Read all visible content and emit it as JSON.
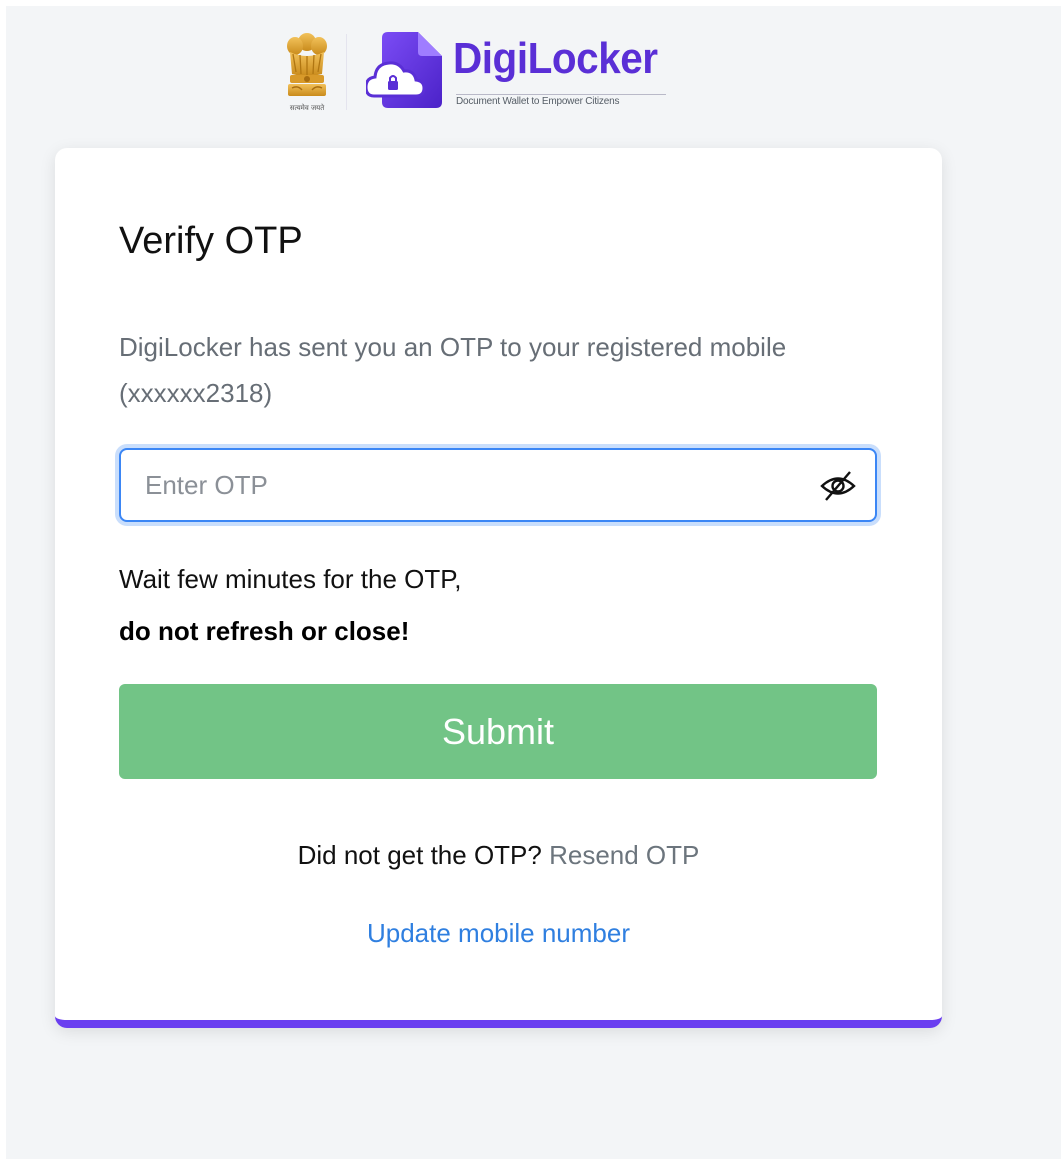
{
  "header": {
    "emblem_caption": "सत्यमेव जयते",
    "brand_name": "DigiLocker",
    "brand_tagline": "Document Wallet to Empower Citizens"
  },
  "card": {
    "title": "Verify OTP",
    "description": "DigiLocker has sent you an OTP to your registered mobile (xxxxxx2318)",
    "otp_input": {
      "placeholder": "Enter OTP",
      "value": ""
    },
    "visibility_icon": "eye-off-icon",
    "wait_message": "Wait few minutes for the OTP,",
    "warning_message": "do not refresh or close!",
    "submit_label": "Submit",
    "resend_prompt": "Did not get the OTP?",
    "resend_link": "Resend OTP",
    "update_mobile_link": "Update mobile number"
  },
  "colors": {
    "brand_purple": "#5a2fd6",
    "card_accent_border": "#6a3ef0",
    "submit_green": "#72c486",
    "input_focus_blue": "#3b86f5",
    "link_blue": "#2f7fe0",
    "background": "#f3f5f7"
  }
}
